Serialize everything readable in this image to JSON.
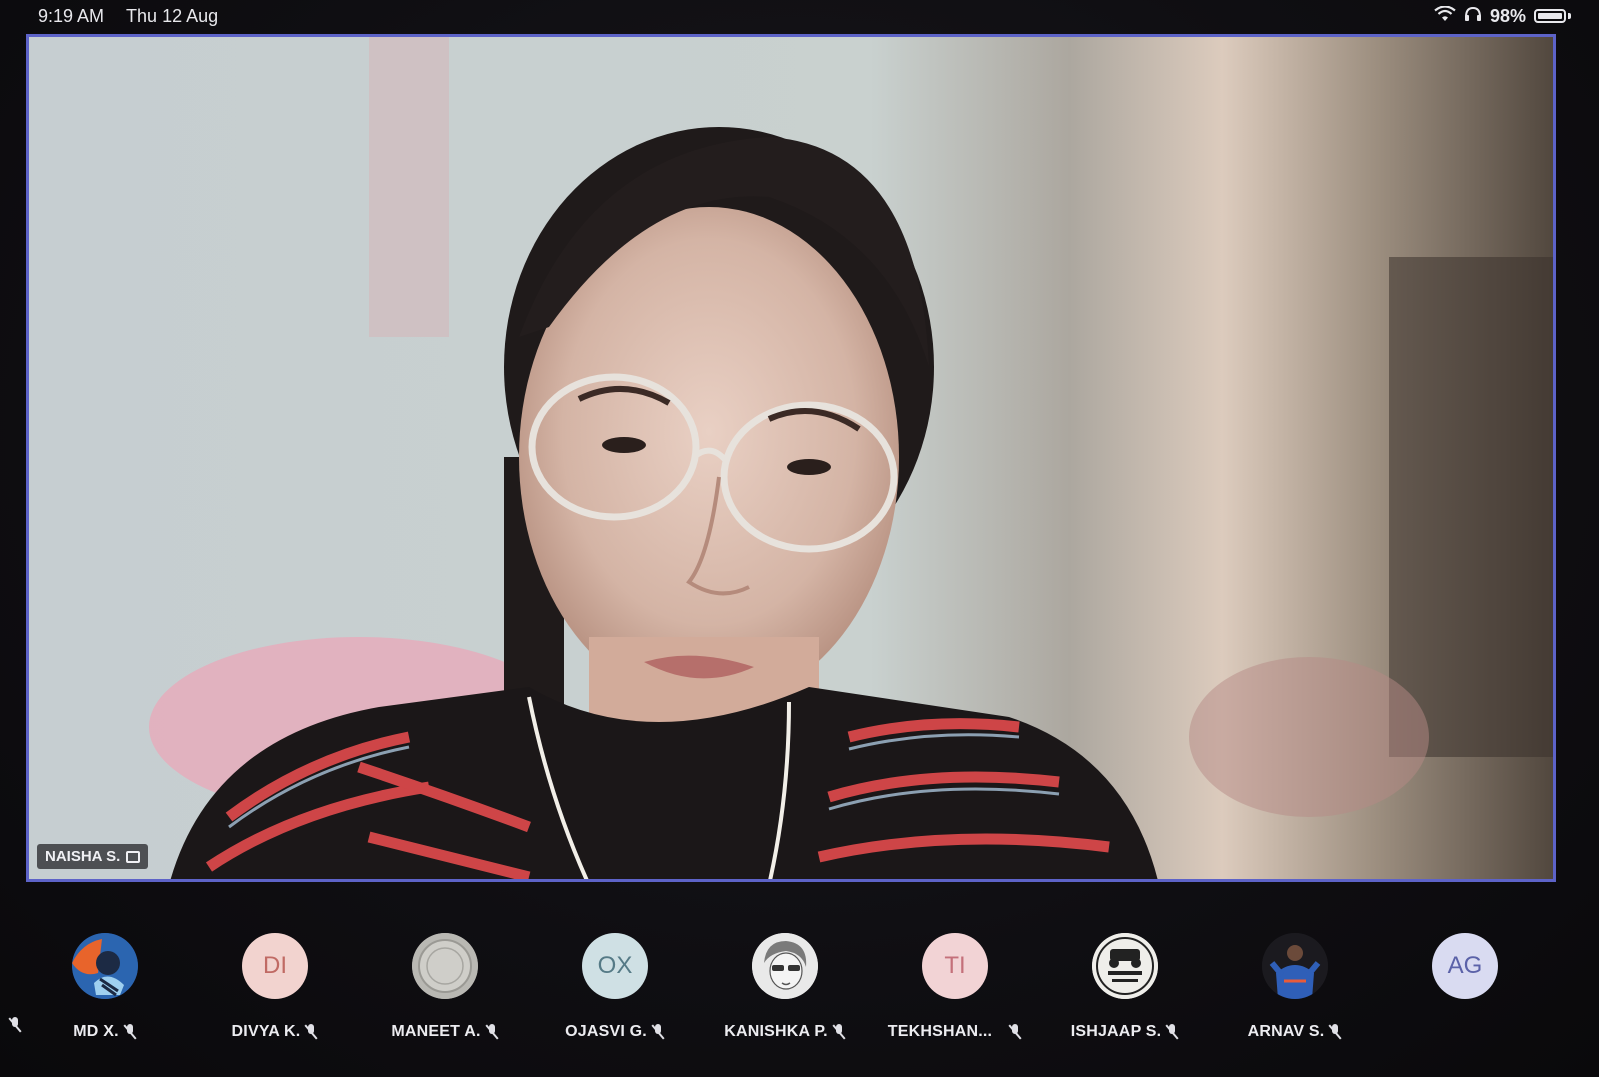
{
  "status_bar": {
    "time": "9:19 AM",
    "date": "Thu 12 Aug",
    "battery": "98%",
    "icons": [
      "wifi-icon",
      "headphones-icon",
      "battery-icon"
    ]
  },
  "active_speaker": {
    "name": "NAISHA S.",
    "highlight_color": "#5d63c8"
  },
  "participants": [
    {
      "label": "MD X.",
      "avatar_text": "",
      "avatar_kind": "image-cartoon",
      "muted": true
    },
    {
      "label": "DIVYA K.",
      "avatar_text": "DI",
      "avatar_kind": "initials",
      "bg": "#f2d3cf",
      "fg": "#c06a64",
      "muted": true
    },
    {
      "label": "MANEET A.",
      "avatar_text": "",
      "avatar_kind": "image-coin",
      "muted": true
    },
    {
      "label": "OJASVI G.",
      "avatar_text": "OX",
      "avatar_kind": "initials",
      "bg": "#cfe0e4",
      "fg": "#557a86",
      "muted": true
    },
    {
      "label": "KANISHKA P.",
      "avatar_text": "",
      "avatar_kind": "image-sketch",
      "muted": true
    },
    {
      "label": "TEKHSHAN...",
      "avatar_text": "TI",
      "avatar_kind": "initials",
      "bg": "#f2d3d5",
      "fg": "#c4707a",
      "muted": true
    },
    {
      "label": "ISHJAAP S.",
      "avatar_text": "",
      "avatar_kind": "image-badge",
      "muted": true
    },
    {
      "label": "ARNAV S.",
      "avatar_text": "",
      "avatar_kind": "image-player",
      "muted": true
    },
    {
      "label": "",
      "avatar_text": "AG",
      "avatar_kind": "initials",
      "bg": "#d9dbf1",
      "fg": "#5b62a8",
      "muted": false
    }
  ]
}
